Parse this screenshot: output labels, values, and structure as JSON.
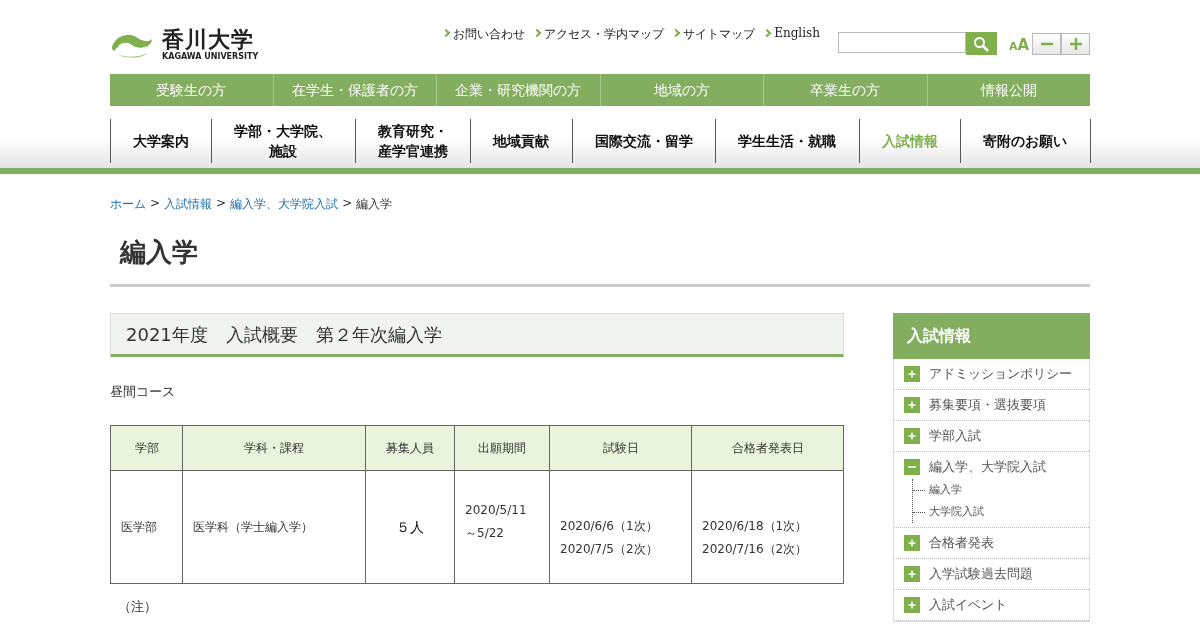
{
  "header": {
    "logo": {
      "name": "香川大学",
      "name_en": "KAGAWA UNIVERSITY"
    },
    "utility_links": [
      "お問い合わせ",
      "アクセス・学内マップ",
      "サイトマップ",
      "English"
    ],
    "font_size": {
      "small": "A",
      "large": "A"
    }
  },
  "audience_nav": [
    "受験生の方",
    "在学生・保護者の方",
    "企業・研究機関の方",
    "地域の方",
    "卒業生の方",
    "情報公開"
  ],
  "main_nav": [
    {
      "label": "大学案内",
      "selected": false
    },
    {
      "label": [
        "学部・大学院、",
        "施設"
      ],
      "selected": false
    },
    {
      "label": [
        "教育研究・",
        "産学官連携"
      ],
      "selected": false
    },
    {
      "label": "地域貢献",
      "selected": false
    },
    {
      "label": "国際交流・留学",
      "selected": false
    },
    {
      "label": "学生生活・就職",
      "selected": false
    },
    {
      "label": "入試情報",
      "selected": true
    },
    {
      "label": "寄附のお願い",
      "selected": false
    }
  ],
  "breadcrumb": {
    "links": [
      "ホーム",
      "入試情報",
      "編入学、大学院入試"
    ],
    "separator": ">",
    "current": "編入学"
  },
  "page_title": "編入学",
  "section_heading": "2021年度　入試概要　第２年次編入学",
  "course_label": "昼間コース",
  "table": {
    "columns": [
      "学部",
      "学科・課程",
      "募集人員",
      "出願期間",
      "試験日",
      "合格者発表日"
    ],
    "rows": [
      {
        "cells": [
          "医学部",
          "医学科（学士編入学）",
          "５人",
          "2020/5/11\n～5/22",
          "2020/6/6（1次）\n2020/7/5（2次）",
          "2020/6/18（1次）\n2020/7/16（2次）"
        ]
      }
    ]
  },
  "note_label": "（注）",
  "sidebar": {
    "title": "入試情報",
    "items": [
      {
        "label": "アドミッションポリシー",
        "expanded": false
      },
      {
        "label": "募集要項・選抜要項",
        "expanded": false
      },
      {
        "label": "学部入試",
        "expanded": false
      },
      {
        "label": "編入学、大学院入試",
        "expanded": true,
        "children": [
          "編入学",
          "大学院入試"
        ]
      },
      {
        "label": "合格者発表",
        "expanded": false
      },
      {
        "label": "入学試験過去問題",
        "expanded": false
      },
      {
        "label": "入試イベント",
        "expanded": false
      }
    ]
  }
}
